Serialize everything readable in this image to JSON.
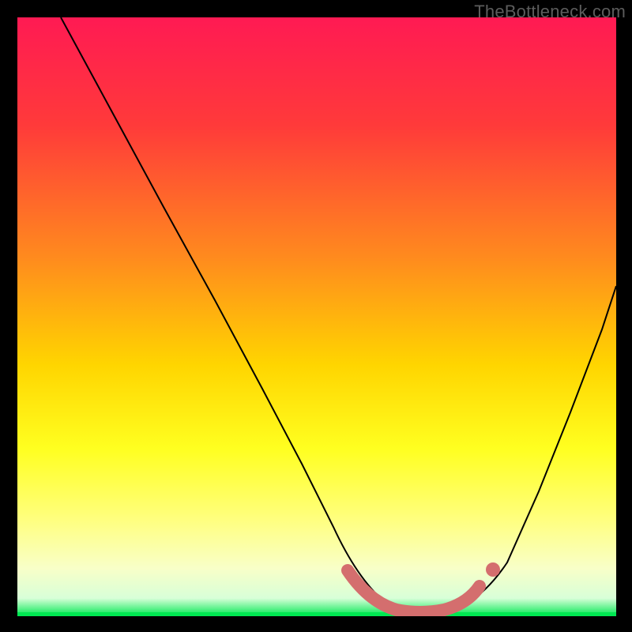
{
  "watermark": "TheBottleneck.com",
  "colors": {
    "bg_black": "#000000",
    "grad_top": "#ff1a53",
    "grad_mid1": "#ff6a2a",
    "grad_mid2": "#ffd500",
    "grad_low1": "#ffff70",
    "grad_low2": "#f8ffdc",
    "grad_bottom": "#00e852",
    "curve": "#000000",
    "marker": "#d86a6a",
    "watermark": "#5c5c5c"
  },
  "chart_data": {
    "type": "line",
    "title": "",
    "xlabel": "",
    "ylabel": "",
    "xlim": [
      0,
      100
    ],
    "ylim": [
      0,
      100
    ],
    "grid": false,
    "legend": false,
    "annotations": [],
    "series": [
      {
        "name": "bottleneck-curve",
        "x": [
          10,
          15,
          20,
          25,
          30,
          35,
          40,
          45,
          50,
          53,
          56,
          59,
          62,
          65,
          68,
          71,
          74,
          78,
          82,
          86,
          90,
          94,
          98
        ],
        "y": [
          100,
          90,
          80,
          70,
          60,
          50,
          41,
          32,
          23,
          17,
          11,
          6,
          2,
          0,
          0,
          0,
          2,
          7,
          15,
          25,
          36,
          48,
          61
        ]
      }
    ],
    "markers": {
      "name": "flat-bottom-highlight",
      "x": [
        56,
        58,
        60,
        62,
        64,
        66,
        68,
        70,
        72,
        74
      ],
      "y": [
        9,
        6,
        4,
        2,
        1,
        1,
        1,
        2,
        3,
        5
      ],
      "style": "thick-pink"
    }
  }
}
